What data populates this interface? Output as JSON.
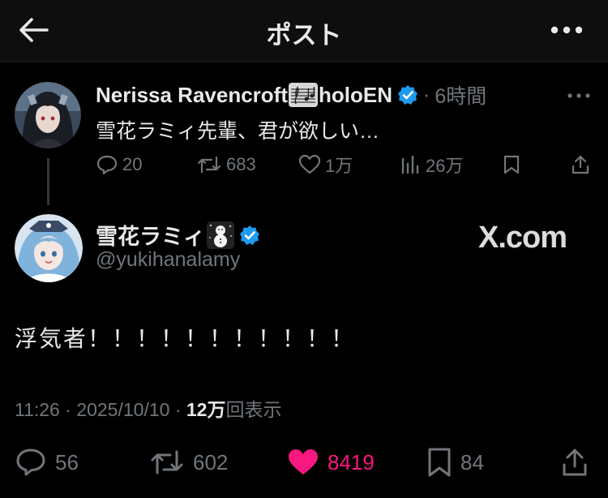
{
  "header": {
    "title": "ポスト",
    "back_icon": "arrow-left-icon",
    "more_icon": "more-horizontal-icon"
  },
  "reply_post": {
    "display_name": "Nerissa Ravencroft",
    "name_suffix": "holoEN",
    "name_emoji_icon": "musical-score-icon",
    "verified_icon": "verified-badge-icon",
    "separator": "·",
    "time": "6時間",
    "text": "雪花ラミィ先輩、君が欲しい…",
    "stats": {
      "replies": "20",
      "reposts": "683",
      "likes": "1万",
      "views": "26万"
    }
  },
  "main_post": {
    "display_name": "雪花ラミィ",
    "name_emoji_icon": "snowman-icon",
    "verified_icon": "verified-badge-icon",
    "handle": "@yukihanalamy",
    "watermark": "X.com",
    "text": "浮気者！！！！！！！！！！！",
    "meta": {
      "time": "11:26",
      "sep1": "·",
      "date": "2025/10/10",
      "sep2": "·",
      "views_number": "12万",
      "views_label": "回表示"
    },
    "stats": {
      "replies": "56",
      "reposts": "602",
      "likes": "8419",
      "bookmarks": "84"
    }
  },
  "colors": {
    "background": "#000000",
    "text": "#e7e9ea",
    "secondary": "#71767b",
    "verified": "#1d9bf0",
    "like": "#f91880"
  }
}
